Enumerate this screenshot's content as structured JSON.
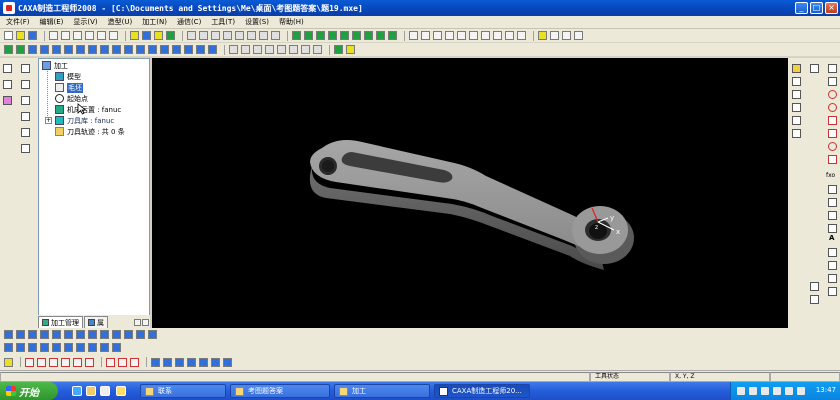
{
  "window": {
    "title": "CAXA制造工程师2008 - [C:\\Documents and Settings\\Me\\桌面\\考图题答案\\题19.mxe]",
    "minimize": "_",
    "maximize": "□",
    "close": "×"
  },
  "menu": [
    "文件(F)",
    "编辑(E)",
    "显示(V)",
    "造型(U)",
    "加工(N)",
    "通信(C)",
    "工具(T)",
    "设置(S)",
    "帮助(H)"
  ],
  "tree": {
    "root": "加工",
    "expand_symbol": "+",
    "items": [
      {
        "label": "模型"
      },
      {
        "label": "毛坯"
      },
      {
        "label": "起始点"
      },
      {
        "label": "机床后置 : fanuc"
      },
      {
        "label": "刀具库 : fanuc"
      },
      {
        "label": "刀具轨迹 : 共 0 条"
      }
    ]
  },
  "panel_tabs": [
    {
      "label": "加工管理"
    },
    {
      "label": "属"
    }
  ],
  "viewport": {
    "axis_labels": {
      "x": "x",
      "y": "y",
      "z": "z"
    },
    "colors": {
      "background": "#000000",
      "part": "#8c8c8c",
      "axis_x": "#ffffff",
      "axis_y": "#ffffff",
      "axis_z": "#e02020"
    }
  },
  "right_strip": {
    "text_tool": "A",
    "fxo_label": "fxo"
  },
  "statusbar": {
    "tool_state": "工具状态",
    "coords": "X, Y, Z"
  },
  "taskbar": {
    "start_label": "开始",
    "tasks": [
      {
        "label": "联系"
      },
      {
        "label": "考图题答案"
      },
      {
        "label": "加工"
      },
      {
        "label": "CAXA制造工程师20..."
      }
    ],
    "clock": "13:47"
  }
}
